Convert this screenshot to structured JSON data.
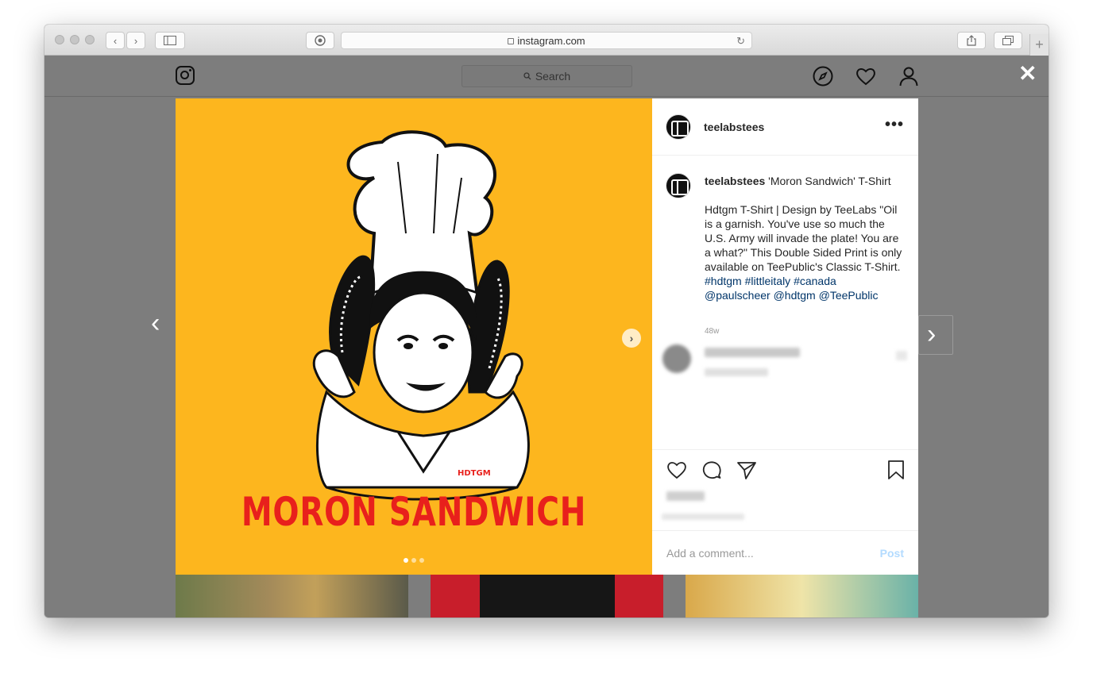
{
  "browser": {
    "url": "instagram.com",
    "new_tab_label": "+"
  },
  "header": {
    "search_placeholder": "Search"
  },
  "post": {
    "image_caption_art": "MORON SANDWICH",
    "art_signature": "HDTGM",
    "username": "teelabstees",
    "caption": {
      "username": "teelabstees",
      "title": "'Moron Sandwich' T-Shirt",
      "body": "Hdtgm T-Shirt | Design by TeeLabs \"Oil is a garnish. You've use so much the U.S. Army will invade the plate! You are a what?\" This Double Sided Print is only available on TeePublic's Classic T-Shirt.",
      "hashtags": [
        "#hdtgm",
        "#littleitaly",
        "#canada"
      ],
      "mentions": [
        "@paulscheer",
        "@hdtgm",
        "@TeePublic"
      ]
    },
    "posted_ago": "48w",
    "more_label": "•••",
    "add_comment_placeholder": "Add a comment...",
    "post_button": "Post",
    "carousel": {
      "count": 3,
      "active_index": 0
    },
    "next_label": "›"
  },
  "colors": {
    "image_bg": "#fdb61e",
    "art_text": "#e8201c",
    "link": "#003569",
    "post_disabled": "#b3dbff"
  },
  "icons": {
    "header": [
      "instagram-logo-icon",
      "explore-compass-icon",
      "activity-heart-icon",
      "profile-person-icon"
    ],
    "actions": [
      "like-heart-icon",
      "comment-bubble-icon",
      "share-send-icon",
      "save-bookmark-icon"
    ]
  }
}
